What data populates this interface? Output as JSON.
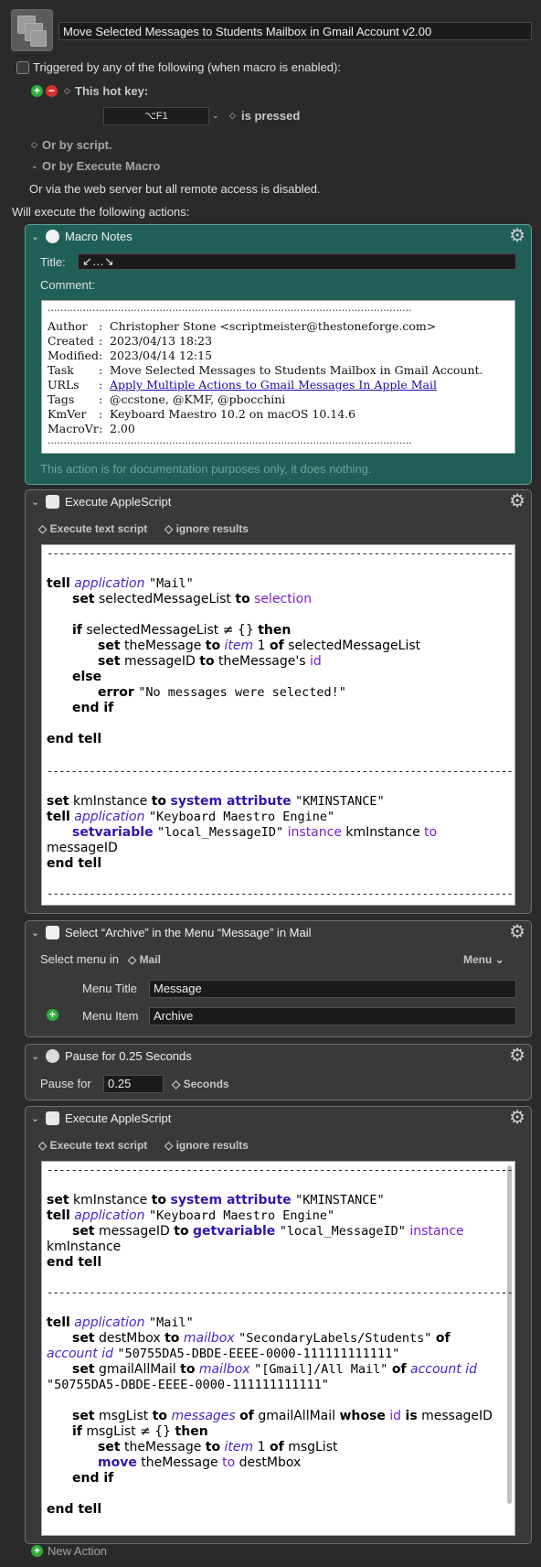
{
  "macro": {
    "name": "Move Selected Messages to Students Mailbox in Gmail Account v2.00",
    "trigger_header": "Triggered by any of the following (when macro is enabled):",
    "hotkey_label": "This hot key:",
    "hotkey_value": "⌥F1",
    "hotkey_state": "is pressed",
    "by_script": "Or by script.",
    "by_execute_macro": "Or by Execute Macro",
    "web_server": "Or via the web server but all remote access is disabled.",
    "will_execute": "Will execute the following actions:",
    "new_action": "New Action"
  },
  "notes_action": {
    "title": "Macro Notes",
    "title_label": "Title:",
    "title_value": "↙…↘",
    "comment_label": "Comment:",
    "dotted_rule": "..................................................................................................................",
    "rows": [
      {
        "key": "Author",
        "value": "Christopher Stone <scriptmeister@thestoneforge.com>"
      },
      {
        "key": "Created",
        "value": "2023/04/13 18:23"
      },
      {
        "key": "Modified",
        "value": "2023/04/14 12:15"
      },
      {
        "key": "Task",
        "value": "Move Selected Messages to Students Mailbox in Gmail Account."
      },
      {
        "key": "URLs",
        "value": "Apply Multiple Actions to Gmail Messages In Apple Mail"
      },
      {
        "key": "Tags",
        "value": "@ccstone, @KMF, @pbocchini"
      },
      {
        "key": "KmVer",
        "value": "Keyboard Maestro 10.2 on macOS 10.14.6"
      },
      {
        "key": "MacroVr",
        "value": "2.00"
      }
    ],
    "colon": ":",
    "footer": "This action is for documentation purposes only, it does nothing."
  },
  "applescript1": {
    "title": "Execute AppleScript",
    "opt_execute": "Execute text script",
    "opt_results": "ignore results",
    "rule": "------------------------------------------------------------------------------------------",
    "tell": "tell",
    "application": "application",
    "mail_str": "\"Mail\"",
    "set": "set",
    "selectedMessageList": "selectedMessageList",
    "to": "to",
    "selection": "selection",
    "if": "if",
    "ne_empty": "≠ {}",
    "then": "then",
    "theMessage": "theMessage",
    "item": "item",
    "one": "1",
    "of": "of",
    "messageID": "messageID",
    "theMessages": "theMessage's",
    "id": "id",
    "else": "else",
    "error": "error",
    "no_msg_str": "\"No messages were selected!\"",
    "end_if": "end if",
    "end_tell": "end tell",
    "kmInstance": "kmInstance",
    "system_attribute": "system attribute",
    "kminstance_str": "\"KMINSTANCE\"",
    "km_engine_str": "\"Keyboard Maestro Engine\"",
    "setvariable": "setvariable",
    "local_id_str": "\"local_MessageID\"",
    "instance": "instance"
  },
  "menu_action": {
    "title": "Select “Archive” in the Menu “Message” in Mail",
    "select_menu_in": "Select menu in",
    "app": "Mail",
    "menu_dropdown": "Menu",
    "menu_title_label": "Menu Title",
    "menu_title_value": "Message",
    "menu_item_label": "Menu Item",
    "menu_item_value": "Archive"
  },
  "pause_action": {
    "title": "Pause for 0.25 Seconds",
    "label": "Pause for",
    "value": "0.25",
    "unit": "Seconds"
  },
  "applescript2": {
    "title": "Execute AppleScript",
    "opt_execute": "Execute text script",
    "opt_results": "ignore results",
    "getvariable": "getvariable",
    "destMbox": "destMbox",
    "mailbox": "mailbox",
    "students_str": "\"SecondaryLabels/Students\"",
    "account": "account id",
    "account_str": "\"50755DA5-DBDE-EEEE-0000-111111111111\"",
    "gmailAllMail": "gmailAllMail",
    "allmail_str": "\"[Gmail]/All Mail\"",
    "msgList": "msgList",
    "messages": "messages",
    "whose": "whose",
    "is": "is",
    "move": "move"
  }
}
